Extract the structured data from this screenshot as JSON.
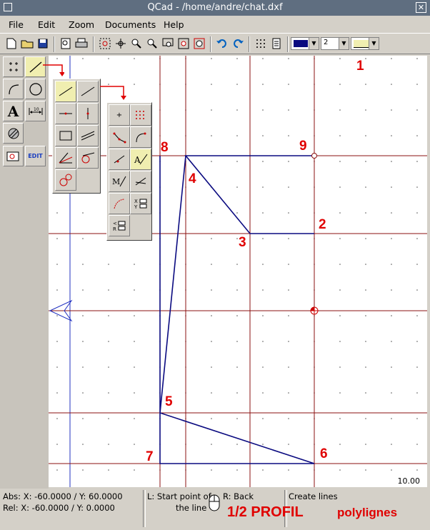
{
  "window": {
    "title": "QCad - /home/andre/chat.dxf"
  },
  "menu": [
    "File",
    "Edit",
    "Zoom",
    "Documents",
    "Help"
  ],
  "toolbar": {
    "line_width": "2"
  },
  "canvas": {
    "scale_label": "10.00",
    "points": [
      {
        "label": "1"
      },
      {
        "label": "2"
      },
      {
        "label": "3"
      },
      {
        "label": "4"
      },
      {
        "label": "5"
      },
      {
        "label": "6"
      },
      {
        "label": "7"
      },
      {
        "label": "8"
      },
      {
        "label": "9"
      }
    ]
  },
  "status": {
    "abs": "Abs: X: -60.0000 / Y: 60.0000",
    "rel": "Rel: X: -60.0000 / Y: 0.0000",
    "left_hint_1": "L: Start point of",
    "left_hint_2": "the line",
    "right_hint": "R: Back",
    "action": "Create lines",
    "overlay_main": "1/2 PROFIL",
    "overlay_sub": "polylignes"
  },
  "colors": {
    "grid_red": "#8b1010",
    "line_blue": "#0a0a80",
    "accent_red": "#e00000"
  }
}
